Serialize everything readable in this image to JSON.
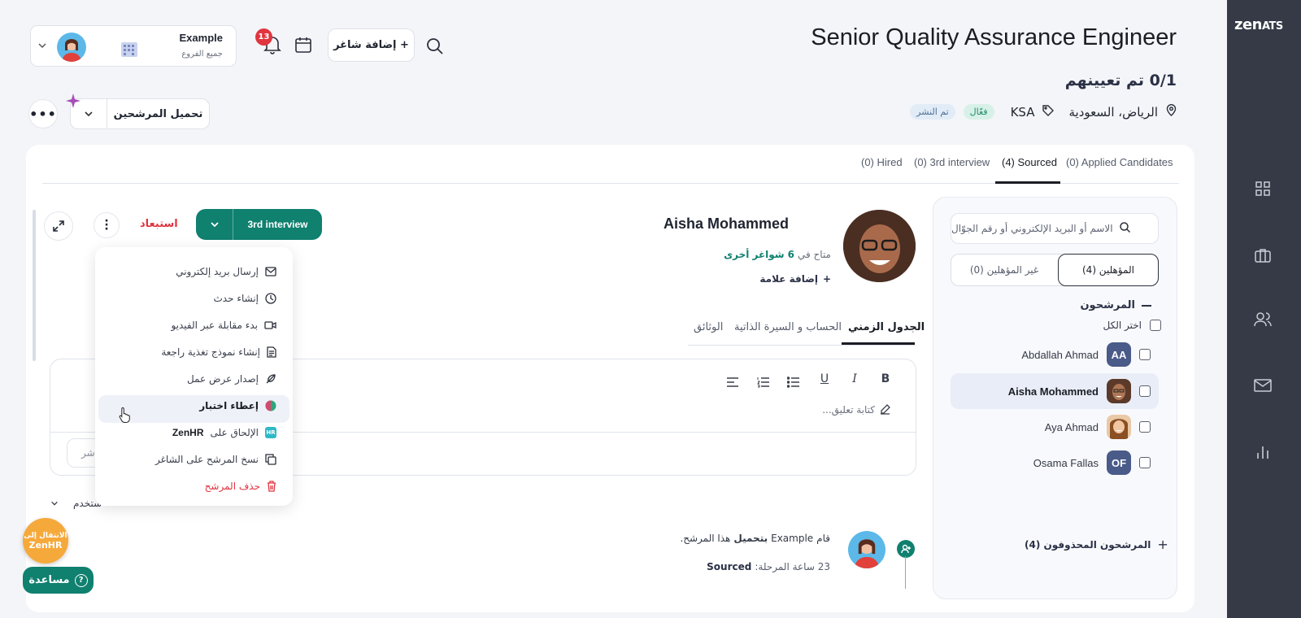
{
  "brand": {
    "name": "zen",
    "suffix": "ATS"
  },
  "header": {
    "job_title": "Senior Quality Assurance Engineer",
    "assigned": "0/1 تم تعيينهم",
    "location": "الرياض، السعودية",
    "country_tag": "KSA",
    "status_active": "فعّال",
    "status_published": "تم النشر",
    "add_vacancy": "+ إضافة شاغر",
    "notification_count": "13",
    "user_name": "Example",
    "user_branch": "جميع الفروع",
    "upload_candidates": "تحميل المرشحين"
  },
  "tabs": [
    {
      "label": "(0) Hired"
    },
    {
      "label": "(0) 3rd interview"
    },
    {
      "label": "(4) Sourced"
    },
    {
      "label": "(0) Applied Candidates"
    }
  ],
  "candidates_panel": {
    "search_placeholder": "الاسم أو البريد الإلكتروني أو رقم الجوّال",
    "qualified_tab": "المؤهلين (4)",
    "unqualified_tab": "غير المؤهلين (0)",
    "group_title": "المرشحون",
    "select_all": "اختر الكل",
    "candidates": [
      {
        "name": "Abdallah Ahmad",
        "initials": "AA"
      },
      {
        "name": "Aisha Mohammed",
        "initials": ""
      },
      {
        "name": "Aya Ahmad",
        "initials": ""
      },
      {
        "name": "Osama Fallas",
        "initials": "OF"
      }
    ],
    "deleted": "المرشحون المحذوفون (4)"
  },
  "profile": {
    "name": "Aisha Mohammed",
    "available_prefix": "متاح في",
    "available_count": "6",
    "available_suffix": "شواغر أخرى",
    "add_tag": "إضافة علامة",
    "stage": "3rd interview",
    "reject": "استبعاد",
    "tabs": [
      "الجدول الزمني",
      "الحساب و السيرة الذاتية",
      "الوثائق"
    ]
  },
  "actions_menu": [
    {
      "label": "إرسال بريد إلكتروني",
      "icon": "mail-icon"
    },
    {
      "label": "إنشاء حدث",
      "icon": "clock-icon"
    },
    {
      "label": "بدء مقابلة عبر الفيديو",
      "icon": "video-icon"
    },
    {
      "label": "إنشاء نموذج تغذية راجعة",
      "icon": "document-icon"
    },
    {
      "label": "إصدار عرض عمل",
      "icon": "feather-icon"
    },
    {
      "label": "إعطاء اختبار",
      "icon": "test-icon"
    },
    {
      "label_prefix": "الإلحاق على",
      "label_brand": "ZenHR",
      "icon": "zenhr-icon"
    },
    {
      "label": "نسخ المرشح على الشاغر",
      "icon": "copy-icon"
    },
    {
      "label": "حذف المرشح",
      "icon": "trash-icon"
    }
  ],
  "editor": {
    "placeholder": "كتابة تعليق...",
    "publish_partial": "شر",
    "user_filter_partial": "ستخدم"
  },
  "activity": {
    "actor": "Example",
    "verb": "بتحميل",
    "object": "هذا المرشح.",
    "lead": "قام",
    "time": "23 ساعة المرحلة:",
    "stage": "Sourced"
  },
  "floating": {
    "zenhr_line1": "الانتقال إلى",
    "zenhr_line2": "ZenHR",
    "help": "مساعدة"
  },
  "colors": {
    "accent": "#10806f",
    "rail": "#353a46",
    "danger": "#e0353f"
  }
}
